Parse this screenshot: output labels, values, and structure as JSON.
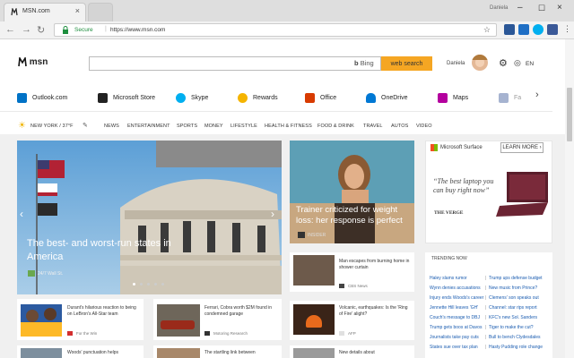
{
  "browser": {
    "tab_title": "MSN.com",
    "profile_name": "Daniela",
    "secure_label": "Secure",
    "url": "https://www.msn.com"
  },
  "header": {
    "logo_text": "msn",
    "search_value": "",
    "bing_label": "Bing",
    "search_button": "web search",
    "user_name": "Daniela",
    "language": "EN"
  },
  "shortcuts": [
    {
      "label": "Outlook.com",
      "icon": "outlook-icon",
      "color": "#0072c6"
    },
    {
      "label": "Microsoft Store",
      "icon": "store-icon",
      "color": "#222222"
    },
    {
      "label": "Skype",
      "icon": "skype-icon",
      "color": "#00aff0"
    },
    {
      "label": "Rewards",
      "icon": "rewards-icon",
      "color": "#f5b400"
    },
    {
      "label": "Office",
      "icon": "office-icon",
      "color": "#d83b01"
    },
    {
      "label": "OneDrive",
      "icon": "onedrive-icon",
      "color": "#0078d4"
    },
    {
      "label": "Maps",
      "icon": "maps-icon",
      "color": "#b4009e"
    },
    {
      "label": "Fa",
      "icon": "facebook-icon",
      "color": "#3b5998"
    }
  ],
  "categories": {
    "weather": "NEW YORK / 37°F",
    "items": [
      "NEWS",
      "ENTERTAINMENT",
      "SPORTS",
      "MONEY",
      "LIFESTYLE",
      "HEALTH & FITNESS",
      "FOOD & DRINK",
      "TRAVEL",
      "AUTOS",
      "VIDEO"
    ]
  },
  "hero": {
    "title": "The best- and worst-run states in America",
    "source": "24/7 Wall St."
  },
  "story2": {
    "title": "Trainer criticized for weight loss: her response is perfect",
    "source": "INSIDER"
  },
  "ad": {
    "brand": "Microsoft Surface",
    "cta": "LEARN MORE",
    "text": "“The best laptop you can buy right now”",
    "verge": "THE VERGE"
  },
  "side_cards": [
    {
      "text": "Man escapes from burning home in shower curtain",
      "source": "CBS News"
    },
    {
      "text": "Volcanic, earthquakes: Is the 'Ring of Fire' alight?",
      "source": "AFP"
    },
    {
      "text": "New details about",
      "source": ""
    }
  ],
  "bottom_cards": [
    {
      "text": "Durant's hilarious reaction to being on LeBron's All-Star team",
      "source": "For the Win"
    },
    {
      "text": "Ferrari, Cobra worth $2M found in condemned garage",
      "source": "Motoring Research"
    },
    {
      "text": "Woods' punctuation helps",
      "source": ""
    },
    {
      "text": "The startling link between",
      "source": ""
    }
  ],
  "trending": {
    "title": "TRENDING NOW",
    "items": [
      "Haley slams rumor",
      "Trump ups defense budget",
      "Wynn denies accusations",
      "New music from Prince?",
      "Injury ends Woods's career",
      "Clemens' son speaks out",
      "Jennette Hill leaves 'GH'",
      "Channel: star rips report",
      "Couch's message to DBJ",
      "KFC's new Sol. Sanders",
      "Trump gets boos at Davos",
      "Tiger to make the cut?",
      "Journalists take pay cuts",
      "Bull to bench Clydesdales",
      "States sue over tax plan",
      "Hasty Pudding role change"
    ]
  }
}
